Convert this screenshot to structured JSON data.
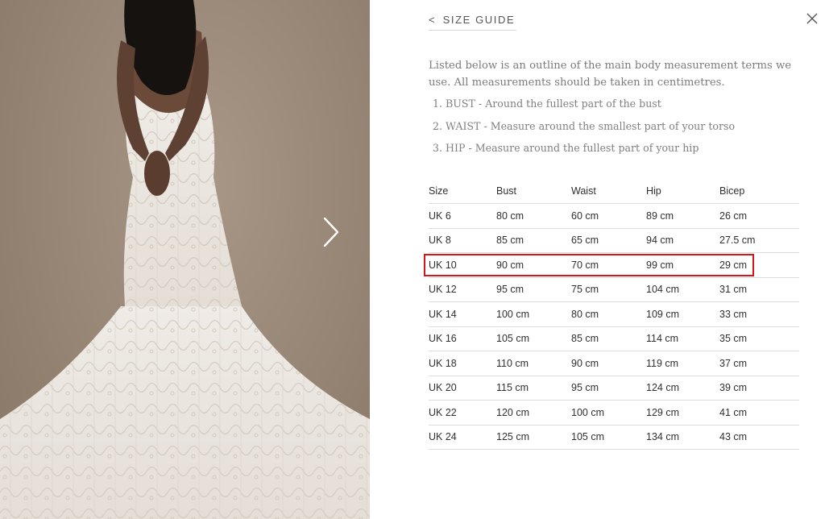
{
  "header": {
    "back_chevron": "<",
    "title": "SIZE GUIDE",
    "close_icon": "close-icon"
  },
  "intro": "Listed below is an outline of the main body measurement terms we use. All measurements should be taken in centimetres.",
  "measurements": [
    {
      "num": "1.",
      "text": "BUST - Around the fullest part of the bust"
    },
    {
      "num": "2.",
      "text": "WAIST - Measure around the smallest part of your torso"
    },
    {
      "num": "3.",
      "text": "HIP - Measure around the fullest part of your hip"
    }
  ],
  "table": {
    "headers": [
      "Size",
      "Bust",
      "Waist",
      "Hip",
      "Bicep"
    ],
    "rows": [
      [
        "UK 6",
        "80 cm",
        "60 cm",
        "89 cm",
        "26 cm"
      ],
      [
        "UK 8",
        "85 cm",
        "65 cm",
        "94 cm",
        "27.5 cm"
      ],
      [
        "UK 10",
        "90 cm",
        "70 cm",
        "99 cm",
        "29 cm"
      ],
      [
        "UK 12",
        "95 cm",
        "75 cm",
        "104 cm",
        "31 cm"
      ],
      [
        "UK 14",
        "100 cm",
        "80 cm",
        "109 cm",
        "33 cm"
      ],
      [
        "UK 16",
        "105 cm",
        "85 cm",
        "114 cm",
        "35 cm"
      ],
      [
        "UK 18",
        "110 cm",
        "90 cm",
        "119 cm",
        "37 cm"
      ],
      [
        "UK 20",
        "115 cm",
        "95 cm",
        "124 cm",
        "39 cm"
      ],
      [
        "UK 22",
        "120 cm",
        "100 cm",
        "129 cm",
        "41 cm"
      ],
      [
        "UK 24",
        "125 cm",
        "105 cm",
        "134 cm",
        "43 cm"
      ]
    ],
    "highlighted_row": "UK 10"
  },
  "gallery": {
    "next_icon": "chevron-right-icon",
    "image": "wedding-dress-back-view-photo"
  },
  "colors": {
    "highlight": "#d8141b",
    "photo_bg": "#968574",
    "text_muted": "#7b7b7b"
  }
}
